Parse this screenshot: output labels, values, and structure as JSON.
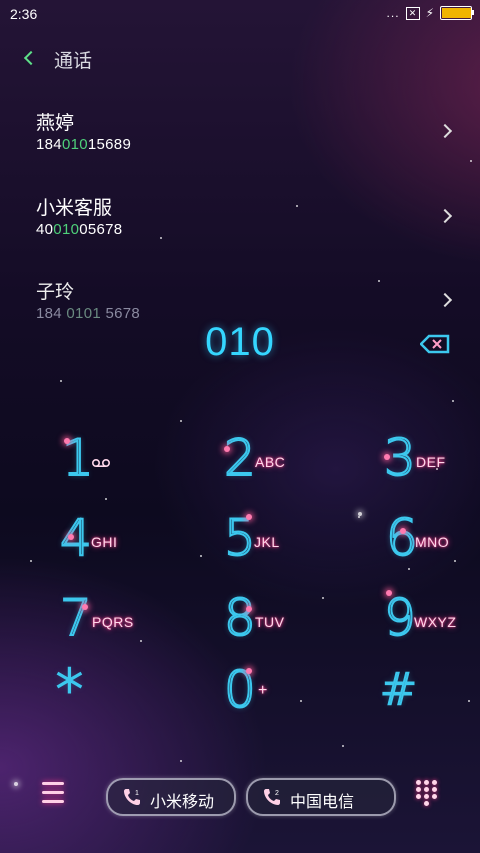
{
  "status_bar": {
    "time": "2:36",
    "signal_dots": "...",
    "box_icon": "x-box-icon",
    "bolt": "⚡",
    "battery_level_pct": 95
  },
  "header": {
    "title": "通话"
  },
  "contacts": [
    {
      "name": "燕婷",
      "number_pre": "184",
      "number_hl": "010",
      "number_post": "15689"
    },
    {
      "name": "小米客服",
      "number_pre": "40",
      "number_hl": "010",
      "number_post": "05678"
    },
    {
      "name": "子玲",
      "number_pre": "184 ",
      "number_hl": "0101",
      "number_post": " 5678"
    }
  ],
  "dial_input": {
    "value": "010"
  },
  "keypad": [
    {
      "digit": "1",
      "letters": ""
    },
    {
      "digit": "2",
      "letters": "ABC"
    },
    {
      "digit": "3",
      "letters": "DEF"
    },
    {
      "digit": "4",
      "letters": "GHI"
    },
    {
      "digit": "5",
      "letters": "JKL"
    },
    {
      "digit": "6",
      "letters": "MNO"
    },
    {
      "digit": "7",
      "letters": "PQRS"
    },
    {
      "digit": "8",
      "letters": "TUV"
    },
    {
      "digit": "9",
      "letters": "WXYZ"
    },
    {
      "digit": "*",
      "letters": ""
    },
    {
      "digit": "0",
      "letters": "+"
    },
    {
      "digit": "#",
      "letters": ""
    }
  ],
  "bottom_bar": {
    "sim1": {
      "slot": "1",
      "label": "小米移动"
    },
    "sim2": {
      "slot": "2",
      "label": "中国电信"
    }
  },
  "colors": {
    "accent_green": "#4ed07a",
    "digit_cyan": "#35d6ff",
    "glow_pink": "#ff3c8c"
  }
}
